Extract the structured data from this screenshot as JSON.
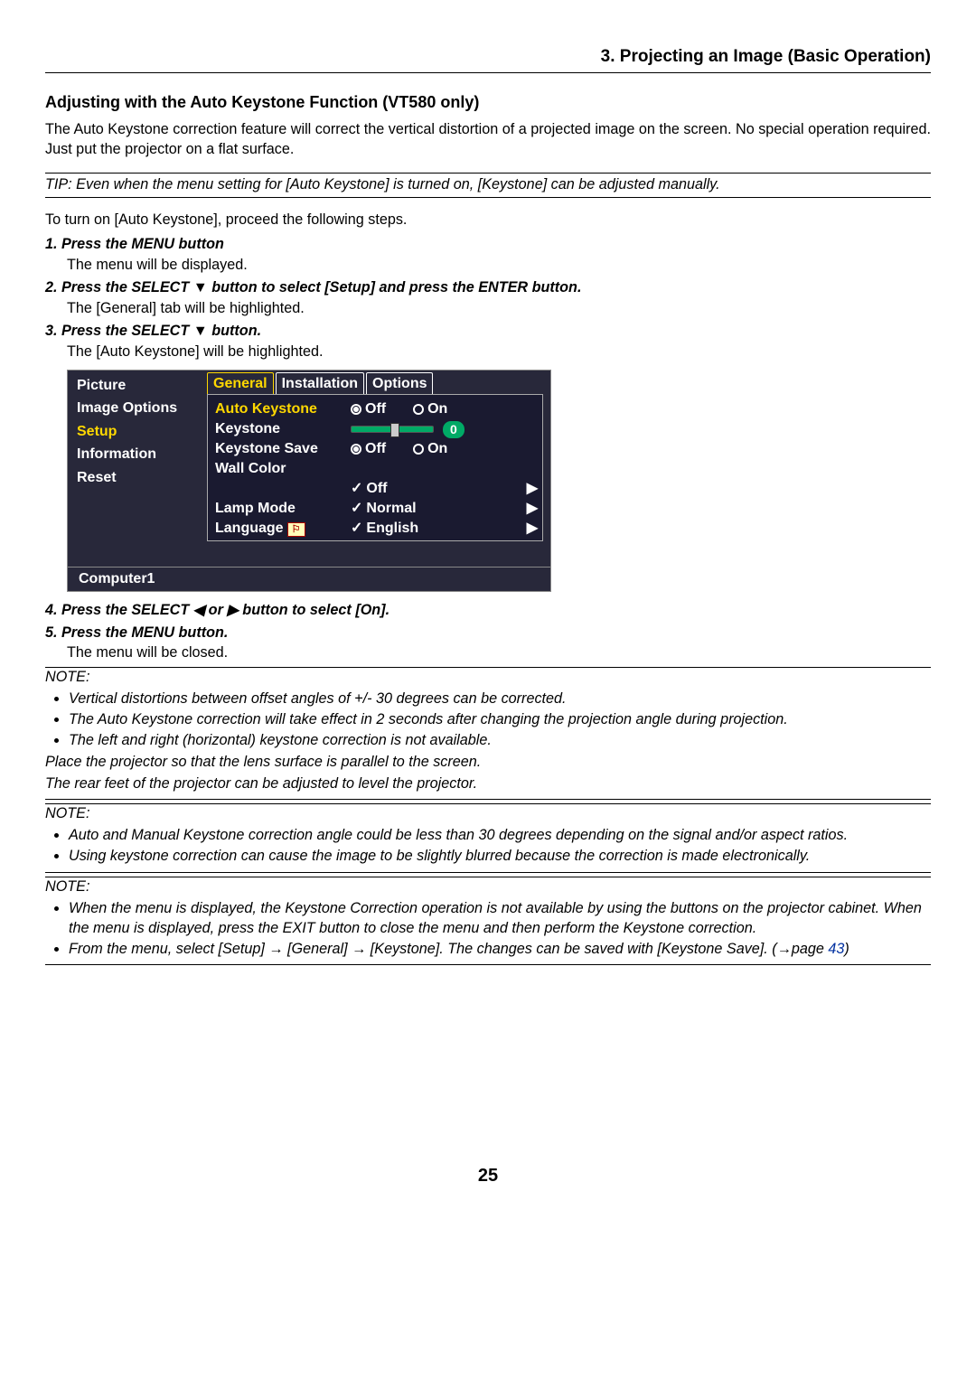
{
  "chapter": "3. Projecting an Image (Basic Operation)",
  "section": "Adjusting with the Auto Keystone Function (VT580 only)",
  "intro": "The Auto Keystone correction feature will correct the vertical distortion of a projected image on the screen. No special operation required. Just put the projector on a flat surface.",
  "tip": "TIP: Even when the menu setting for [Auto Keystone] is turned on, [Keystone] can be adjusted manually.",
  "lead": "To turn on [Auto Keystone], proceed the following steps.",
  "step1": "1.  Press the MENU button",
  "step1s": "The menu will be displayed.",
  "step2": "2.  Press the SELECT ▼ button to select [Setup] and press the ENTER button.",
  "step2s": "The [General] tab will be highlighted.",
  "step3": "3.  Press the SELECT ▼ button.",
  "step3s": "The [Auto Keystone] will be highlighted.",
  "step4": "4.  Press the SELECT ◀ or ▶ button to select [On].",
  "step5": "5.  Press the MENU button.",
  "step5s": "The menu will be closed.",
  "note1head": "NOTE:",
  "note1a": "Vertical distortions between offset angles of +/- 30 degrees can be corrected.",
  "note1b": "The Auto Keystone correction will take effect in 2 seconds after changing the projection angle during projection.",
  "note1c": "The left and right (horizontal) keystone correction is not available.",
  "note1p1": "Place the projector so that the lens surface is parallel to the screen.",
  "note1p2": "The rear feet of the projector can be adjusted to level the projector.",
  "note2head": "NOTE:",
  "note2a": "Auto and Manual Keystone correction angle could be less than 30 degrees depending on the signal and/or aspect ratios.",
  "note2b": "Using keystone correction can cause the image to be slightly blurred because the correction is made electronically.",
  "note3head": "NOTE:",
  "note3a": "When the menu is displayed, the Keystone Correction operation is not available by using the buttons on the projector cabinet. When the menu is displayed, press the EXIT button to close the menu and then perform the Keystone correction.",
  "note3b_pre": "From the menu, select [Setup] → [General] → [Keystone]. The changes can be saved with [Keystone Save]. (→page ",
  "note3b_link": "43",
  "note3b_post": ")",
  "menu": {
    "left": {
      "picture": "Picture",
      "imgopt": "Image Options",
      "setup": "Setup",
      "info": "Information",
      "reset": "Reset"
    },
    "tabs": {
      "general": "General",
      "install": "Installation",
      "options": "Options"
    },
    "rows": {
      "auto": "Auto Keystone",
      "keystone": "Keystone",
      "ksave": "Keystone Save",
      "wall": "Wall Color",
      "lamp": "Lamp Mode",
      "lang": "Language"
    },
    "vals": {
      "off": "Off",
      "on": "On",
      "normal": "Normal",
      "english": "English",
      "zero": "0"
    },
    "status": "Computer1"
  },
  "pagenum": "25"
}
